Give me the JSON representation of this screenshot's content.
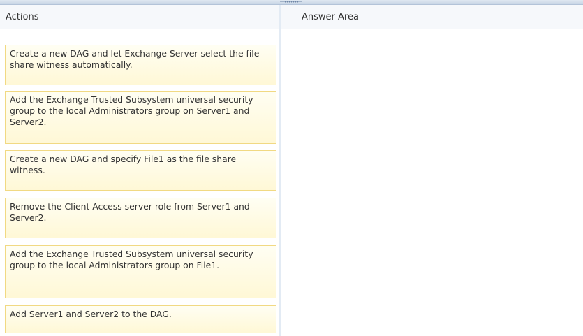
{
  "panes": {
    "actions_title": "Actions",
    "answer_title": "Answer Area"
  },
  "actions": [
    {
      "text": "Create a new DAG and let Exchange Server select the file share witness automatically."
    },
    {
      "text": "Add the Exchange Trusted Subsystem universal security group to the local Administrators group on Server1 and Server2."
    },
    {
      "text": "Create a new DAG and specify File1 as the file share witness."
    },
    {
      "text": "Remove the Client Access server role from Server1 and Server2."
    },
    {
      "text": "Add the Exchange Trusted Subsystem universal security group to the local Administrators group on File1."
    },
    {
      "text": "Add Server1 and Server2 to the DAG."
    }
  ],
  "colors": {
    "card_fill": "#fff8d6",
    "card_border": "#f1d983",
    "header_bg": "#f6f8fb",
    "divider": "#d7e0eb"
  }
}
